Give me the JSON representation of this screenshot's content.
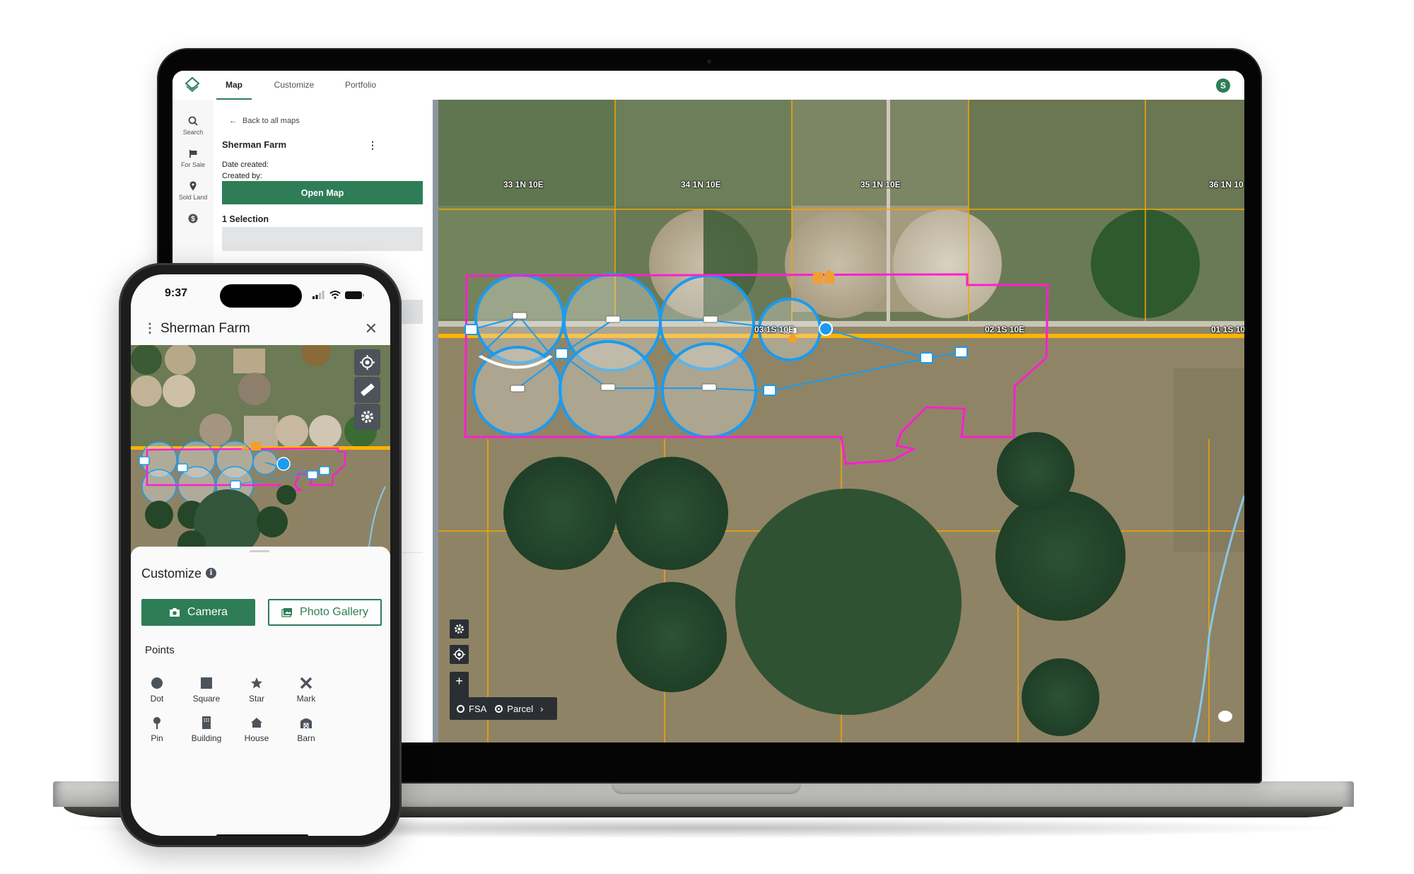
{
  "laptop": {
    "tabs": [
      {
        "label": "Map",
        "active": true
      },
      {
        "label": "Customize",
        "active": false
      },
      {
        "label": "Portfolio",
        "active": false
      }
    ],
    "avatar_initial": "S",
    "sidebar": {
      "items": [
        {
          "label": "Search",
          "icon": "search-icon"
        },
        {
          "label": "For Sale",
          "icon": "flag-icon"
        },
        {
          "label": "Sold Land",
          "icon": "location-pin-icon"
        },
        {
          "label": "",
          "icon": "dollar-icon"
        }
      ]
    },
    "panel": {
      "back_label": "Back to all maps",
      "farm_name": "Sherman Farm",
      "date_created_label": "Date created:",
      "created_by_label": "Created by:",
      "open_map_label": "Open Map",
      "selection_label": "1 Selection"
    },
    "map": {
      "section_labels": [
        {
          "text": "33 1N 10E"
        },
        {
          "text": "34 1N 10E"
        },
        {
          "text": "35 1N 10E"
        },
        {
          "text": "36 1N 10"
        },
        {
          "text": "03 1S 10E"
        },
        {
          "text": "02 1S 10E"
        },
        {
          "text": "01 1S 10"
        }
      ],
      "layer_options": [
        {
          "label": "FSA",
          "selected": false
        },
        {
          "label": "Parcel",
          "selected": true
        }
      ],
      "colors": {
        "boundary": "#ff1fd0",
        "irrigation": "#1a9bf0",
        "parcel_lines": "#f5a500",
        "road": "#ffb300",
        "brand": "#2e7d57"
      }
    }
  },
  "phone": {
    "status_time": "9:37",
    "title": "Sherman Farm",
    "customize": {
      "title": "Customize",
      "camera_label": "Camera",
      "gallery_label": "Photo Gallery",
      "points_label": "Points",
      "points": [
        {
          "label": "Dot",
          "icon": "dot-icon"
        },
        {
          "label": "Square",
          "icon": "square-icon"
        },
        {
          "label": "Star",
          "icon": "star-icon"
        },
        {
          "label": "Mark",
          "icon": "x-mark-icon"
        },
        {
          "label": "Pin",
          "icon": "pin-icon"
        },
        {
          "label": "Building",
          "icon": "building-icon"
        },
        {
          "label": "House",
          "icon": "house-icon"
        },
        {
          "label": "Barn",
          "icon": "barn-icon"
        }
      ]
    }
  }
}
